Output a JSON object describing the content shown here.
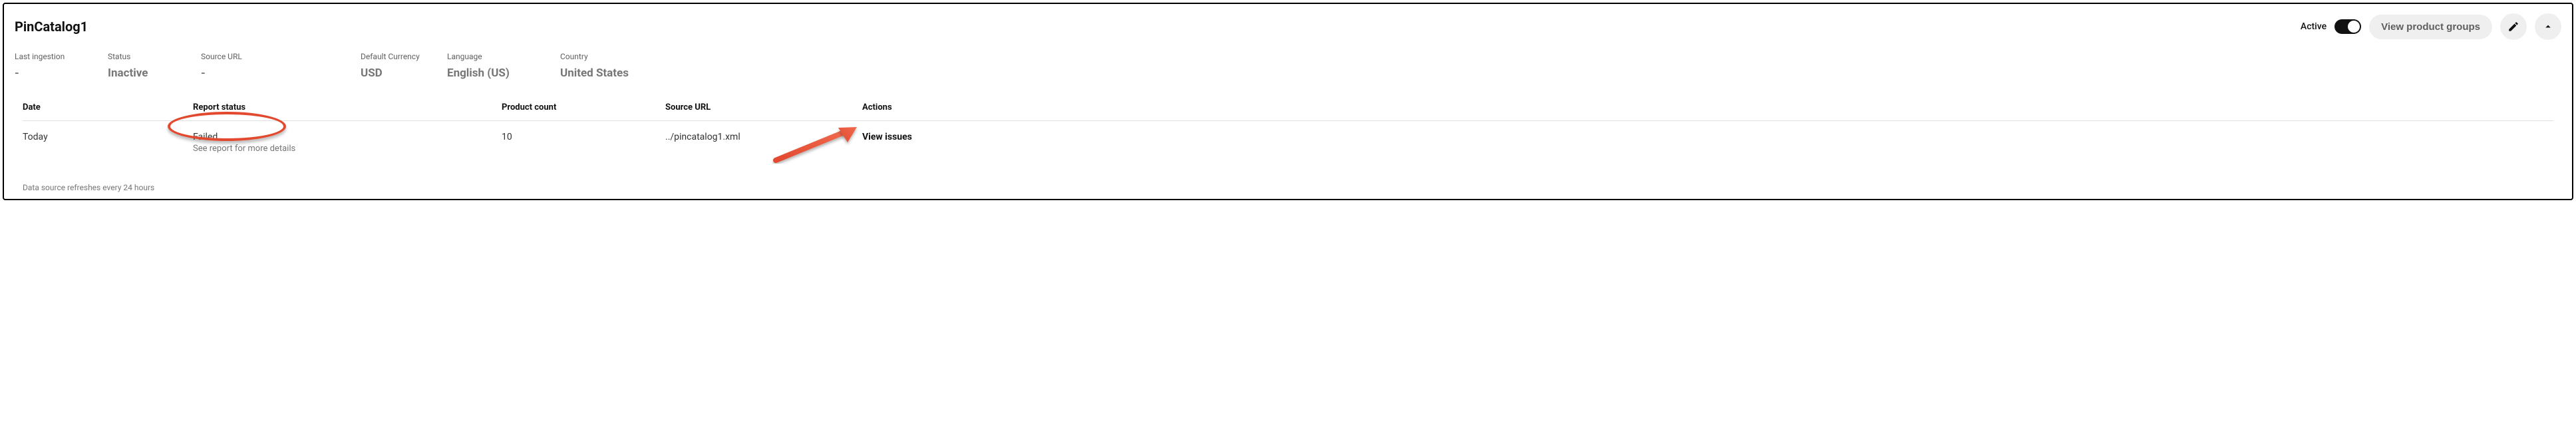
{
  "header": {
    "title": "PinCatalog1",
    "active_label": "Active",
    "view_groups_label": "View product groups"
  },
  "summary": {
    "last_ingestion": {
      "label": "Last ingestion",
      "value": "-"
    },
    "status": {
      "label": "Status",
      "value": "Inactive"
    },
    "source_url": {
      "label": "Source URL",
      "value": "-"
    },
    "default_currency": {
      "label": "Default Currency",
      "value": "USD"
    },
    "language": {
      "label": "Language",
      "value": "English (US)"
    },
    "country": {
      "label": "Country",
      "value": "United States"
    }
  },
  "table": {
    "columns": {
      "date": "Date",
      "report_status": "Report status",
      "product_count": "Product count",
      "source_url": "Source URL",
      "actions": "Actions"
    },
    "rows": [
      {
        "date": "Today",
        "status": "Failed",
        "status_detail": "See report for more details",
        "product_count": "10",
        "source_url": "../pincatalog1.xml",
        "action_label": "View issues"
      }
    ]
  },
  "footer": {
    "refresh_note": "Data source refreshes every 24 hours"
  }
}
